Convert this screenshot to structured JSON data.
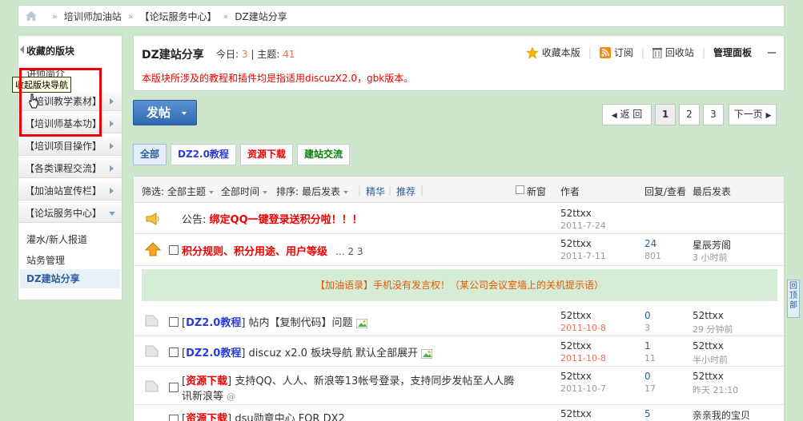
{
  "breadcrumb": {
    "items": [
      "培训师加油站",
      "【论坛服务中心】",
      "DZ建站分享"
    ]
  },
  "sidebar": {
    "favorites_title": "收藏的版块",
    "favorites_sub": "讲师简介",
    "tooltip": "收起版块导航",
    "groups": [
      "【培训教学素材】",
      "【培训师基本功】",
      "【培训项目操作】",
      "【各类课程交流】",
      "【加油站宣传栏】",
      "【论坛服务中心】"
    ],
    "forums": [
      "灌水/新人报道",
      "站务管理",
      "DZ建站分享"
    ]
  },
  "forum": {
    "title": "DZ建站分享",
    "today_label": "今日:",
    "today_value": "3",
    "topic_label": "主题:",
    "topic_value": "41",
    "notice": "本版块所涉及的教程和插件均是指适用discuzX2.0，gbk版本。",
    "tools": {
      "favorite": "收藏本版",
      "subscribe": "订阅",
      "recycle": "回收站",
      "admin": "管理面板"
    }
  },
  "post_button": "发帖",
  "pager": {
    "back": "返 回",
    "pages": [
      "1",
      "2",
      "3"
    ],
    "next": "下一页"
  },
  "type_tabs": [
    "全部",
    "DZ2.0教程",
    "资源下载",
    "建站交流"
  ],
  "filter": {
    "label": "筛选:",
    "all_topics": "全部主题",
    "all_time": "全部时间",
    "sort_label": "排序:",
    "sort_value": "最后发表",
    "digest": "精华",
    "recommend": "推荐",
    "new_window": "新窗",
    "col_author": "作者",
    "col_replies": "回复/查看",
    "col_last": "最后发表"
  },
  "announcement": {
    "prefix": "公告:",
    "title": "绑定QQ一键登录送积分啦！！！",
    "author": "52ttxx",
    "date": "2011-7-24"
  },
  "sticky": {
    "title": "积分规则、积分用途、用户等级",
    "pages": "... 2  3",
    "author": "52ttxx",
    "date": "2011-7-11",
    "replies": "24",
    "views": "801",
    "last_user": "星辰芳阁",
    "last_time": "3 小时前"
  },
  "ad_text": "【加油语录】手机没有发言权！（某公司会议室墙上的关机提示语）",
  "threads": [
    {
      "type": "DZ2.0教程",
      "title": "帖内【复制代码】问题",
      "author": "52ttxx",
      "date": "2011-10-8",
      "replies": "0",
      "views": "3",
      "last_user": "52ttxx",
      "last_time": "29 分钟前"
    },
    {
      "type": "DZ2.0教程",
      "title": "discuz x2.0 板块导航 默认全部展开",
      "author": "52ttxx",
      "date": "2011-10-8",
      "replies": "1",
      "views": "11",
      "last_user": "52ttxx",
      "last_time": "半小时前"
    },
    {
      "type": "资源下载",
      "title": "支持QQ、人人、新浪等13帐号登录，支持同步发帖至人人腾",
      "title2": "讯新浪等",
      "author": "52ttxx",
      "date": "2011-10-7",
      "replies": "0",
      "views": "17",
      "last_user": "52ttxx",
      "last_time": "昨天 21:10"
    },
    {
      "type": "资源下载",
      "title": "dsu勋章中心 FOR DX2",
      "author": "52ttxx",
      "date": "",
      "replies": "5",
      "views": "",
      "last_user": "亲亲我的宝贝",
      "last_time": ""
    }
  ],
  "float_button": "回顶部",
  "colors": {
    "background": "#cde6cd",
    "accent_blue": "#2b5d9b",
    "highlight_red": "#e00000",
    "stat_orange": "#f26c4f"
  }
}
